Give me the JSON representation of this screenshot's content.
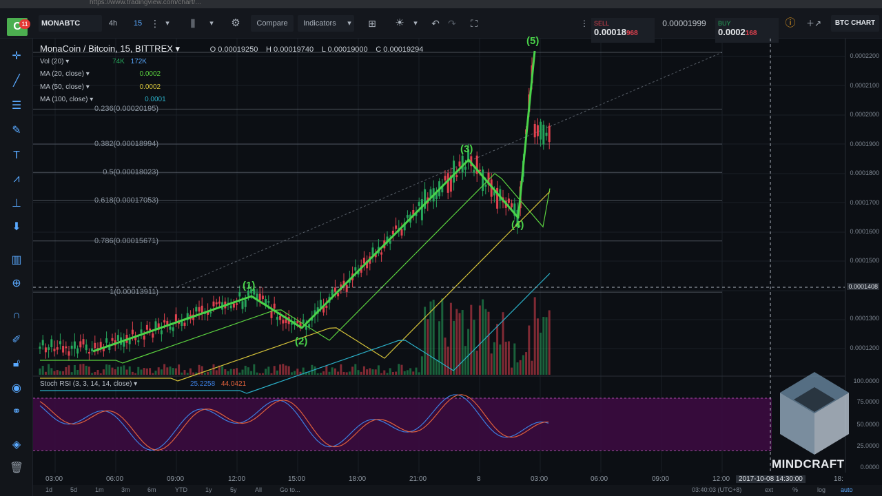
{
  "browser": {
    "url": "https://www.tradingview.com/chart/..."
  },
  "toolbar": {
    "logo": "C",
    "badge": "11",
    "symbol": "MONABTC",
    "interval_4h": "4h",
    "interval_15": "15",
    "compare": "Compare",
    "indicators": "Indicators",
    "sell_label": "SELL",
    "sell_price": "0.00018",
    "sell_sup": "968",
    "spread": "0.00001999",
    "buy_label": "BUY",
    "buy_price": "0.0002",
    "buy_sup": "168",
    "chart_name": "BTC CHART"
  },
  "legend": {
    "title": "MonaCoin / Bitcoin, 15, BITTREX",
    "open": "O 0.00019250",
    "high": "H 0.00019740",
    "low": "L 0.00019000",
    "close": "C 0.00019294",
    "vol_label": "Vol (20)",
    "vol_val1": "74K",
    "vol_val2": "172K",
    "ma20_label": "MA (20, close)",
    "ma20_val": "0.0002",
    "ma50_label": "MA (50, close)",
    "ma50_val": "0.0002",
    "ma100_label": "MA (100, close)",
    "ma100_val": "0.0001",
    "rsi_label": "Stoch RSI (3, 3, 14, 14, close)",
    "rsi_k": "25.2258",
    "rsi_d": "44.0421"
  },
  "fib_levels": [
    {
      "ratio": "0.236(0.00020195)",
      "price": 0.00020195
    },
    {
      "ratio": "0.382(0.00018994)",
      "price": 0.00018994
    },
    {
      "ratio": "0.5(0.00018023)",
      "price": 0.00018023
    },
    {
      "ratio": "0.618(0.00017053)",
      "price": 0.00017053
    },
    {
      "ratio": "0.786(0.00015671)",
      "price": 0.00015671
    },
    {
      "ratio": "1(0.00013911)",
      "price": 0.00013911
    }
  ],
  "price_axis": [
    "0.0002200",
    "0.0002100",
    "0.0002000",
    "0.0001900",
    "0.0001800",
    "0.0001700",
    "0.0001600",
    "0.0001500",
    "0.0001408",
    "0.0001300",
    "0.0001200"
  ],
  "rsi_axis": [
    "100.0000",
    "75.0000",
    "50.0000",
    "25.0000",
    "0.0000"
  ],
  "time_axis": [
    "03:00",
    "06:00",
    "09:00",
    "12:00",
    "15:00",
    "18:00",
    "21:00",
    "8",
    "03:00",
    "06:00",
    "09:00",
    "12:00",
    "2017-10-08 14:30:00",
    "18:"
  ],
  "waves": [
    "(1)",
    "(2)",
    "(3)",
    "(4)",
    "(5)"
  ],
  "bottom_bar": {
    "ranges": [
      "1d",
      "5d",
      "1m",
      "3m",
      "6m",
      "YTD",
      "1y",
      "5y",
      "All"
    ],
    "goto": "Go to...",
    "clock": "03:40:03 (UTC+8)",
    "ext": "ext",
    "pct": "%",
    "log": "log",
    "auto": "auto"
  },
  "watermark": "MINDCRAFT",
  "colors": {
    "accent": "#59a9ff",
    "up": "#26a65b",
    "down": "#e0424f",
    "wave": "#4ad34a",
    "rsi_band": "#3b0b3f"
  }
}
